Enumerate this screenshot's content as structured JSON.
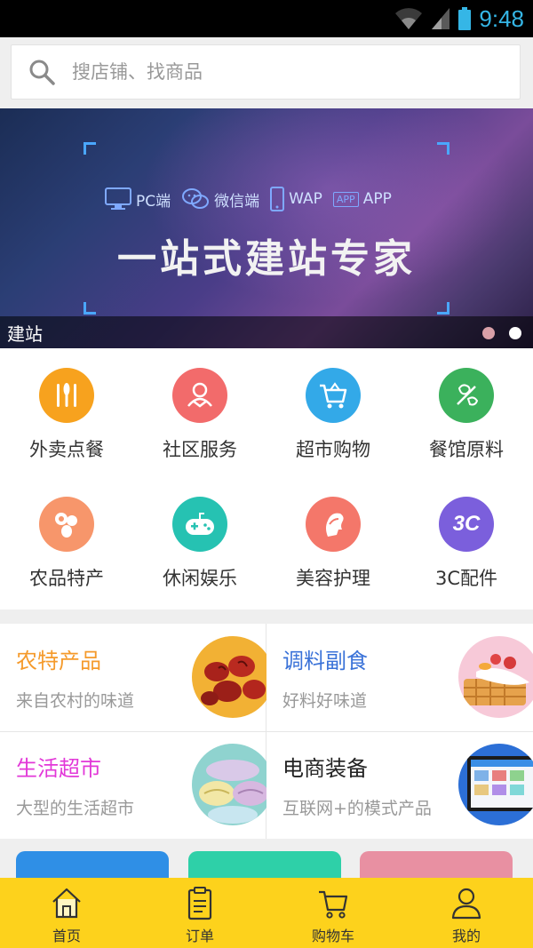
{
  "status_bar": {
    "time": "9:48",
    "icons": [
      "wifi-icon",
      "signal-icon",
      "battery-icon"
    ],
    "color": "#35b6e6"
  },
  "search": {
    "placeholder": "搜店铺、找商品",
    "icon": "search-icon"
  },
  "banner": {
    "platforms": [
      {
        "label": "PC端",
        "icon": "monitor-icon"
      },
      {
        "label": "微信端",
        "icon": "wechat-icon"
      },
      {
        "label": "WAP",
        "icon": "phone-icon"
      },
      {
        "label": "APP",
        "badge": "APP",
        "icon": "app-badge-icon"
      }
    ],
    "slogan": "一站式建站专家",
    "caption": "建站",
    "dots": 2,
    "active_dot": 2
  },
  "categories": [
    {
      "label": "外卖点餐",
      "color": "#f7a21e",
      "icon": "utensils-icon"
    },
    {
      "label": "社区服务",
      "color": "#f26b6b",
      "icon": "community-icon"
    },
    {
      "label": "超市购物",
      "color": "#33a9e8",
      "icon": "cart-icon"
    },
    {
      "label": "餐馆原料",
      "color": "#3bb15c",
      "icon": "ingredients-icon"
    },
    {
      "label": "农品特产",
      "color": "#f7966b",
      "icon": "produce-icon"
    },
    {
      "label": "休闲娱乐",
      "color": "#26c2b2",
      "icon": "gamepad-icon"
    },
    {
      "label": "美容护理",
      "color": "#f4776a",
      "icon": "beauty-icon"
    },
    {
      "label": "3C配件",
      "color": "#7b5fdc",
      "icon": "3c-icon",
      "badge": "3C"
    }
  ],
  "promos": [
    {
      "title": "农特产品",
      "subtitle": "来自农村的味道",
      "color": "#f59a2b",
      "image": "dates-image"
    },
    {
      "title": "调料副食",
      "subtitle": "好料好味道",
      "color": "#3a72d8",
      "image": "waffle-image"
    },
    {
      "title": "生活超市",
      "subtitle": "大型的生活超市",
      "color": "#e238d8",
      "image": "towels-image"
    },
    {
      "title": "电商装备",
      "subtitle": "互联网+的模式产品",
      "color": "#222222",
      "image": "laptop-image"
    }
  ],
  "cards": [
    {
      "color": "#2f8fe6"
    },
    {
      "color": "#2ed0a8"
    },
    {
      "color": "#e890a2"
    }
  ],
  "tabbar": {
    "color": "#fdd21c",
    "items": [
      {
        "label": "首页",
        "icon": "home-icon"
      },
      {
        "label": "订单",
        "icon": "clipboard-icon"
      },
      {
        "label": "购物车",
        "icon": "cart-icon"
      },
      {
        "label": "我的",
        "icon": "user-icon"
      }
    ]
  }
}
